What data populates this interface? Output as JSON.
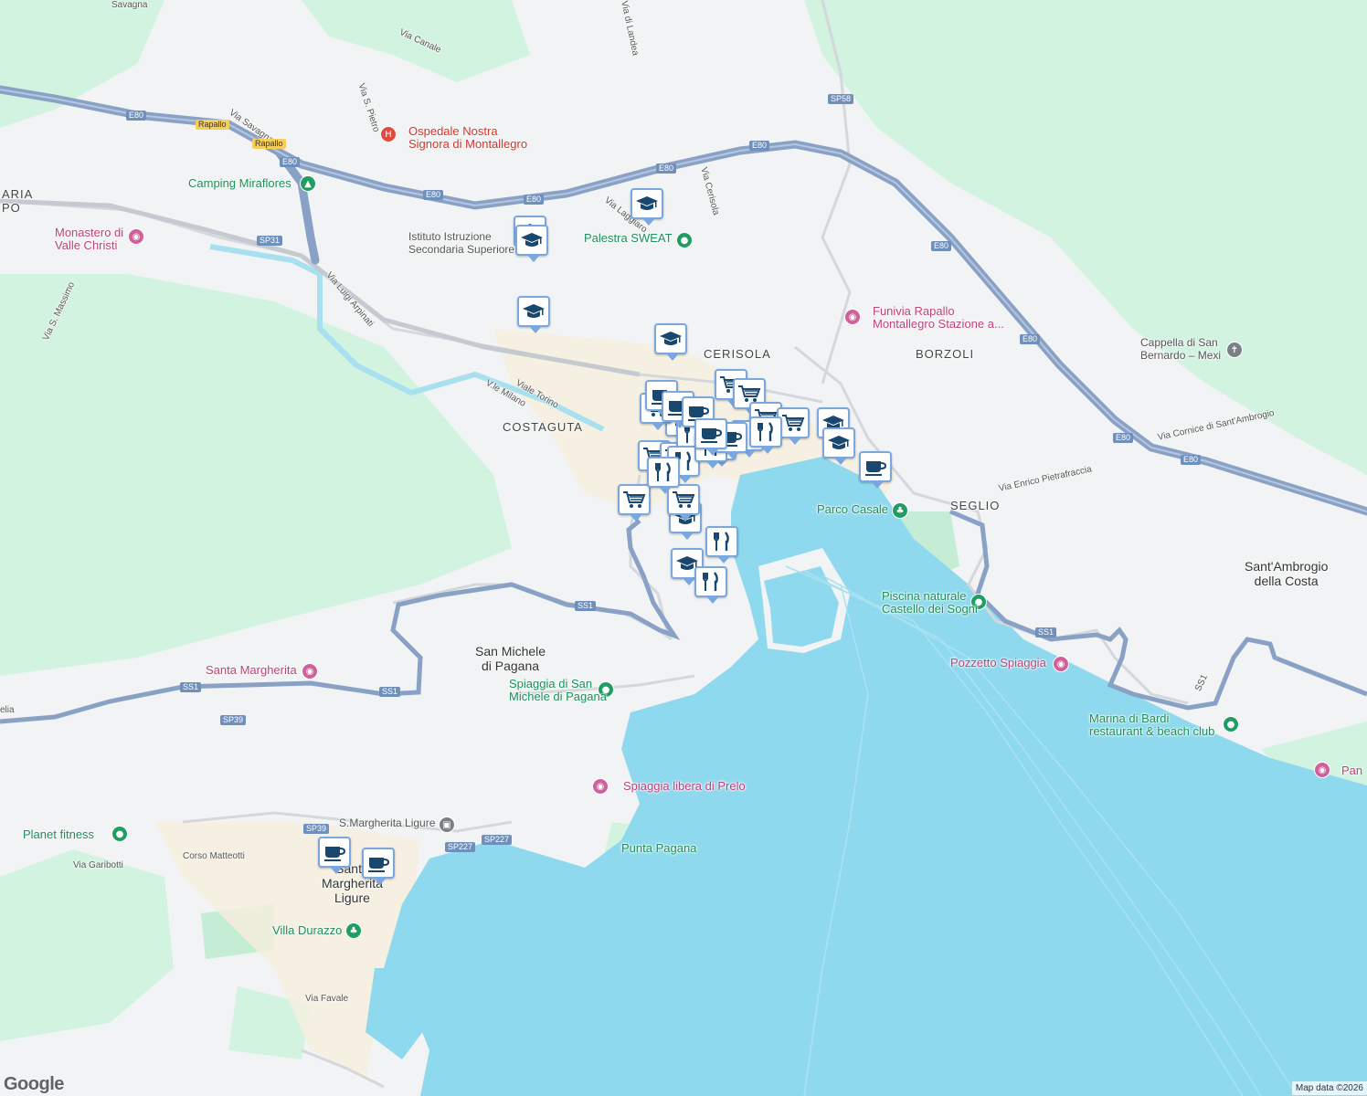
{
  "map": {
    "areas": [
      {
        "key": "cerisola",
        "text": "CERISOLA"
      },
      {
        "key": "borzoli",
        "text": "BORZOLI"
      },
      {
        "key": "costaguta",
        "text": "COSTAGUTA"
      },
      {
        "key": "seglio",
        "text": "SEGLIO"
      },
      {
        "key": "aria",
        "text": "ARIA"
      },
      {
        "key": "po",
        "text": "PO"
      }
    ],
    "towns": [
      {
        "key": "san-michele",
        "text": "San Michele\ndi Pagana"
      },
      {
        "key": "sant-ambrogio",
        "text": "Sant'Ambrogio\ndella Costa"
      },
      {
        "key": "santa-margherita",
        "text": "Santa\nMargherita\nLigure"
      }
    ],
    "roads": [
      {
        "key": "via-canale",
        "text": "Via Canale"
      },
      {
        "key": "via-landea",
        "text": "Via di Landea"
      },
      {
        "key": "via-s-pietro",
        "text": "Via S. Pietro"
      },
      {
        "key": "via-savagna",
        "text": "Via Savagna"
      },
      {
        "key": "savagna",
        "text": "Savagna"
      },
      {
        "key": "via-luigi-arpinati",
        "text": "Via Luigi Arpinati"
      },
      {
        "key": "via-s-massimo",
        "text": "Via S. Massimo"
      },
      {
        "key": "viale-torino",
        "text": "Viale Torino"
      },
      {
        "key": "vle-milano",
        "text": "V.le Milano"
      },
      {
        "key": "via-laggiaro",
        "text": "Via Laggiaro"
      },
      {
        "key": "via-cerisola",
        "text": "Via Cerisola"
      },
      {
        "key": "via-cornice",
        "text": "Via Cornice di Sant'Ambrogio"
      },
      {
        "key": "via-pietrafraccia",
        "text": "Via Enrico Pietrafraccia"
      },
      {
        "key": "corso-matteotti",
        "text": "Corso Matteotti"
      },
      {
        "key": "via-garibotti",
        "text": "Via Garibotti"
      },
      {
        "key": "via-favale",
        "text": "Via Favale"
      },
      {
        "key": "ss1-curve",
        "text": "SS1"
      },
      {
        "key": "aurelia",
        "text": "elia"
      }
    ],
    "shields": [
      {
        "key": "e80-a",
        "text": "E80"
      },
      {
        "key": "e80-b",
        "text": "E80"
      },
      {
        "key": "e80-c",
        "text": "E80"
      },
      {
        "key": "e80-d",
        "text": "E80"
      },
      {
        "key": "e80-e",
        "text": "E80"
      },
      {
        "key": "e80-f",
        "text": "E80"
      },
      {
        "key": "e80-g",
        "text": "E80"
      },
      {
        "key": "e80-h",
        "text": "E80"
      },
      {
        "key": "e80-i",
        "text": "E80"
      },
      {
        "key": "e80-j",
        "text": "E80"
      },
      {
        "key": "rapallo-1",
        "text": "Rapallo"
      },
      {
        "key": "rapallo-2",
        "text": "Rapallo"
      },
      {
        "key": "sp58",
        "text": "SP58"
      },
      {
        "key": "sp31",
        "text": "SP31"
      },
      {
        "key": "ss1-a",
        "text": "SS1"
      },
      {
        "key": "ss1-b",
        "text": "SS1"
      },
      {
        "key": "ss1-c",
        "text": "SS1"
      },
      {
        "key": "ss1-d",
        "text": "SS1"
      },
      {
        "key": "sp39-a",
        "text": "SP39"
      },
      {
        "key": "sp39-b",
        "text": "SP39"
      },
      {
        "key": "sp227-a",
        "text": "SP227"
      },
      {
        "key": "sp227-b",
        "text": "SP227"
      }
    ],
    "pois": [
      {
        "key": "ospedale",
        "text": "Ospedale Nostra\nSignora di Montallegro",
        "kind": "red",
        "icon": "hospital-icon",
        "glyph": "H"
      },
      {
        "key": "camping",
        "text": "Camping Miraflores",
        "kind": "green",
        "icon": "camping-icon",
        "glyph": "▲"
      },
      {
        "key": "monastero",
        "text": "Monastero di\nValle Christi",
        "kind": "pink",
        "icon": "camera-icon",
        "glyph": "◉"
      },
      {
        "key": "istituto",
        "text": "Istituto Istruzione\nSecondaria Superiore...",
        "kind": "grey",
        "icon": "school-icon",
        "glyph": ""
      },
      {
        "key": "palestra",
        "text": "Palestra SWEAT",
        "kind": "green",
        "icon": "gym-icon",
        "glyph": "●"
      },
      {
        "key": "funivia",
        "text": "Funivia Rapallo\nMontallegro Stazione a...",
        "kind": "pink",
        "icon": "camera-icon",
        "glyph": "◉"
      },
      {
        "key": "cappella",
        "text": "Cappella di San\nBernardo – Mexi",
        "kind": "grey",
        "icon": "cross-icon",
        "glyph": "✝"
      },
      {
        "key": "parco-casale",
        "text": "Parco Casale",
        "kind": "green",
        "icon": "park-icon",
        "glyph": "♣"
      },
      {
        "key": "piscina",
        "text": "Piscina naturale\nCastello dei Sogni",
        "kind": "green",
        "icon": "pool-icon",
        "glyph": "●"
      },
      {
        "key": "pozzetto",
        "text": "Pozzetto Spiaggia",
        "kind": "pink",
        "icon": "camera-icon",
        "glyph": "◉"
      },
      {
        "key": "marina-bardi",
        "text": "Marina di Bardi\nrestaurant & beach club",
        "kind": "green",
        "icon": "beach-icon",
        "glyph": "●"
      },
      {
        "key": "pan",
        "text": "Pan",
        "kind": "pink",
        "icon": "camera-icon",
        "glyph": "◉"
      },
      {
        "key": "santa-margherita-poi",
        "text": "Santa Margherita",
        "kind": "pink",
        "icon": "camera-icon",
        "glyph": "◉"
      },
      {
        "key": "spiaggia-san-michele",
        "text": "Spiaggia di San\nMichele di Pagana",
        "kind": "green",
        "icon": "beach-icon",
        "glyph": "●"
      },
      {
        "key": "spiaggia-prelo",
        "text": "Spiaggia libera di Prelo",
        "kind": "pink",
        "icon": "camera-icon",
        "glyph": "◉"
      },
      {
        "key": "planet-fitness",
        "text": "Planet fitness",
        "kind": "green",
        "icon": "gym-icon",
        "glyph": "●"
      },
      {
        "key": "stazione-sml",
        "text": "S.Margherita Ligure",
        "kind": "grey",
        "icon": "train-icon",
        "glyph": "▣"
      },
      {
        "key": "punta-pagana",
        "text": "Punta Pagana",
        "kind": "green",
        "icon": "",
        "glyph": ""
      },
      {
        "key": "villa-durazzo",
        "text": "Villa Durazzo",
        "kind": "green",
        "icon": "park-icon",
        "glyph": "♣"
      }
    ],
    "markers": [
      {
        "type": "school"
      },
      {
        "type": "school"
      },
      {
        "type": "school"
      },
      {
        "type": "school"
      },
      {
        "type": "school"
      },
      {
        "type": "school"
      },
      {
        "type": "school"
      },
      {
        "type": "school"
      },
      {
        "type": "school"
      },
      {
        "type": "school"
      },
      {
        "type": "shopping"
      },
      {
        "type": "shopping"
      },
      {
        "type": "shopping"
      },
      {
        "type": "shopping"
      },
      {
        "type": "shopping"
      },
      {
        "type": "shopping"
      },
      {
        "type": "shopping"
      },
      {
        "type": "shopping"
      },
      {
        "type": "shopping"
      },
      {
        "type": "restaurant"
      },
      {
        "type": "restaurant"
      },
      {
        "type": "restaurant"
      },
      {
        "type": "restaurant"
      },
      {
        "type": "restaurant"
      },
      {
        "type": "restaurant"
      },
      {
        "type": "restaurant"
      },
      {
        "type": "restaurant"
      },
      {
        "type": "restaurant"
      },
      {
        "type": "cafe"
      },
      {
        "type": "cafe"
      },
      {
        "type": "cafe"
      },
      {
        "type": "cafe"
      },
      {
        "type": "cafe"
      },
      {
        "type": "cafe"
      },
      {
        "type": "cafe"
      },
      {
        "type": "cafe"
      }
    ],
    "attribution": "Map data ©2026",
    "logo": "Google",
    "colors": {
      "water": "#8fd9ee",
      "land": "#f1f3f4",
      "green": "#d2f3e0",
      "highway": "#8aa1c6",
      "marker_border": "#7aa7de",
      "marker_icon": "#19476d"
    }
  }
}
